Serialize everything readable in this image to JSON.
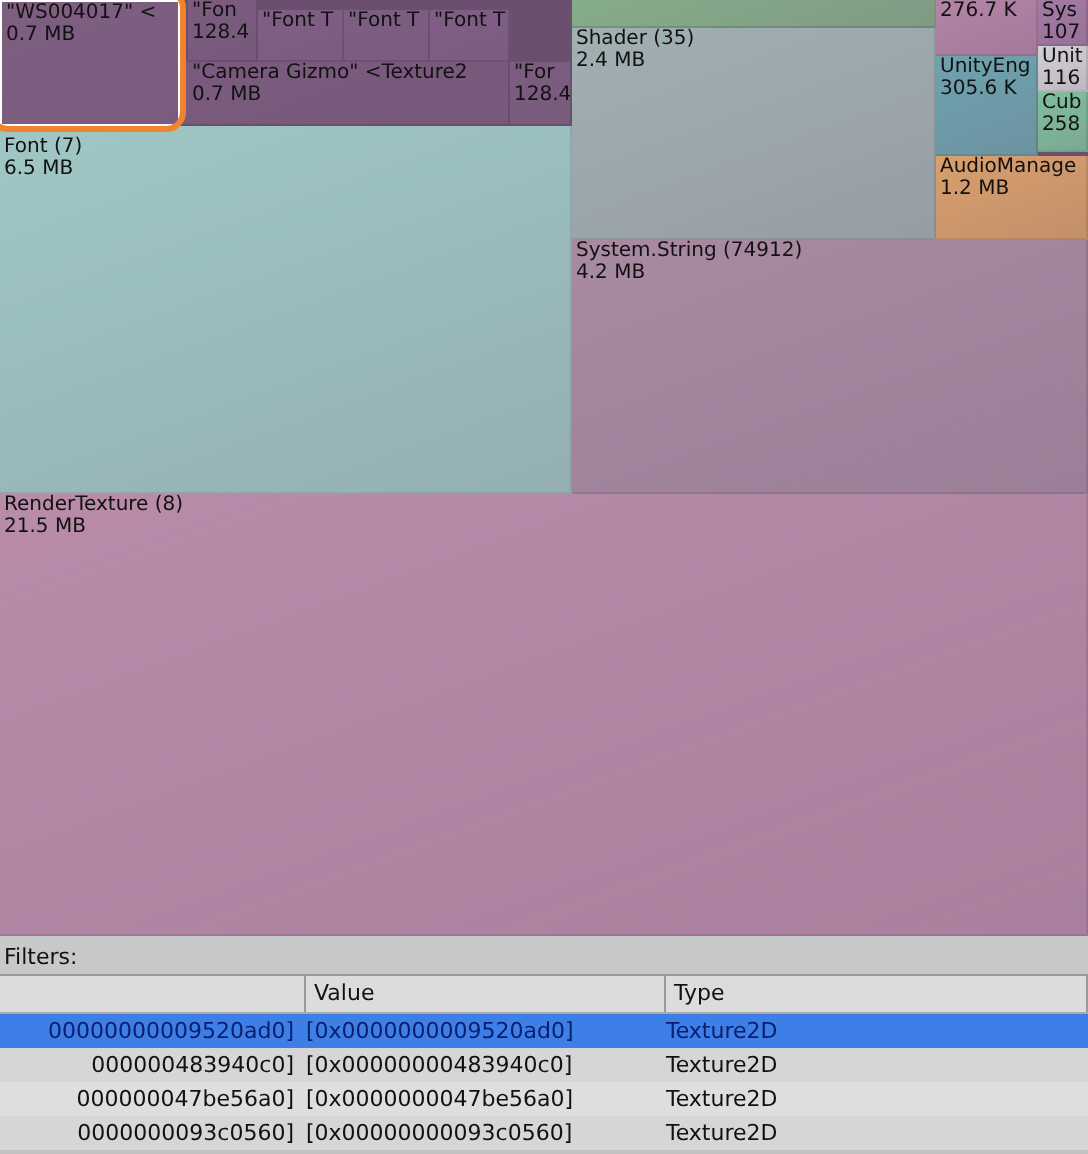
{
  "treemap": {
    "tiles": [
      {
        "label": "\"WS004017\" <",
        "size": "0.7 MB",
        "color": "#7e5f82",
        "selected": true
      },
      {
        "label": "\"Fon",
        "size": "128.4",
        "color": "#7b5c7f",
        "selected": false
      },
      {
        "label": "\"Font T",
        "color": "#805f85",
        "selected": false
      },
      {
        "label": "\"Font T",
        "color": "#7d5f83",
        "selected": false
      },
      {
        "label": "\"Font T",
        "color": "#805f85",
        "selected": false
      },
      {
        "label": "\"Camera Gizmo\" <Texture2",
        "size": "0.7 MB",
        "color": "#7a5b7e",
        "selected": false
      },
      {
        "label": "\"For",
        "size": "128.4",
        "color": "#7c5d80",
        "selected": false
      },
      {
        "label": "Font (7)",
        "size": "6.5 MB",
        "color": "#9fc7c5",
        "selected": false
      },
      {
        "color": "#86ad8a",
        "selected": false
      },
      {
        "label": "Shader (35)",
        "size": "2.4 MB",
        "color": "#a1b0b2",
        "selected": false
      },
      {
        "size": "276.7 K",
        "color": "#b384a6",
        "selected": false
      },
      {
        "label": "Sys",
        "size": "107",
        "color": "#a47aa3",
        "selected": false
      },
      {
        "label": "Unit",
        "size": "116",
        "color": "#d3d0d6",
        "selected": false
      },
      {
        "label": "UnityEng",
        "size": "305.6 K",
        "color": "#6ea3ae",
        "selected": false
      },
      {
        "label": "Cub",
        "size": "258",
        "color": "#7fbf9c",
        "selected": false
      },
      {
        "label": "AudioManage",
        "size": "1.2 MB",
        "color": "#d99f6c",
        "selected": false
      },
      {
        "label": "System.String (74912)",
        "size": "4.2 MB",
        "color": "#a88aa2",
        "selected": false
      },
      {
        "label": "RenderTexture (8)",
        "size": "21.5 MB",
        "color": "#b98ca9",
        "selected": false
      }
    ]
  },
  "filters": {
    "label": "Filters:"
  },
  "table": {
    "columns": [
      "Value",
      "Type"
    ],
    "rows": [
      {
        "column_1": "00000000009520ad0]",
        "value": "[0x0000000009520ad0]",
        "type": "Texture2D",
        "selected": true
      },
      {
        "column_1": "000000483940c0]",
        "value": "[0x00000000483940c0]",
        "type": "Texture2D",
        "selected": false
      },
      {
        "column_1": "000000047be56a0]",
        "value": "[0x0000000047be56a0]",
        "type": "Texture2D",
        "selected": false
      },
      {
        "column_1": "0000000093c0560]",
        "value": "[0x00000000093c0560]",
        "type": "Texture2D",
        "selected": false
      }
    ]
  }
}
